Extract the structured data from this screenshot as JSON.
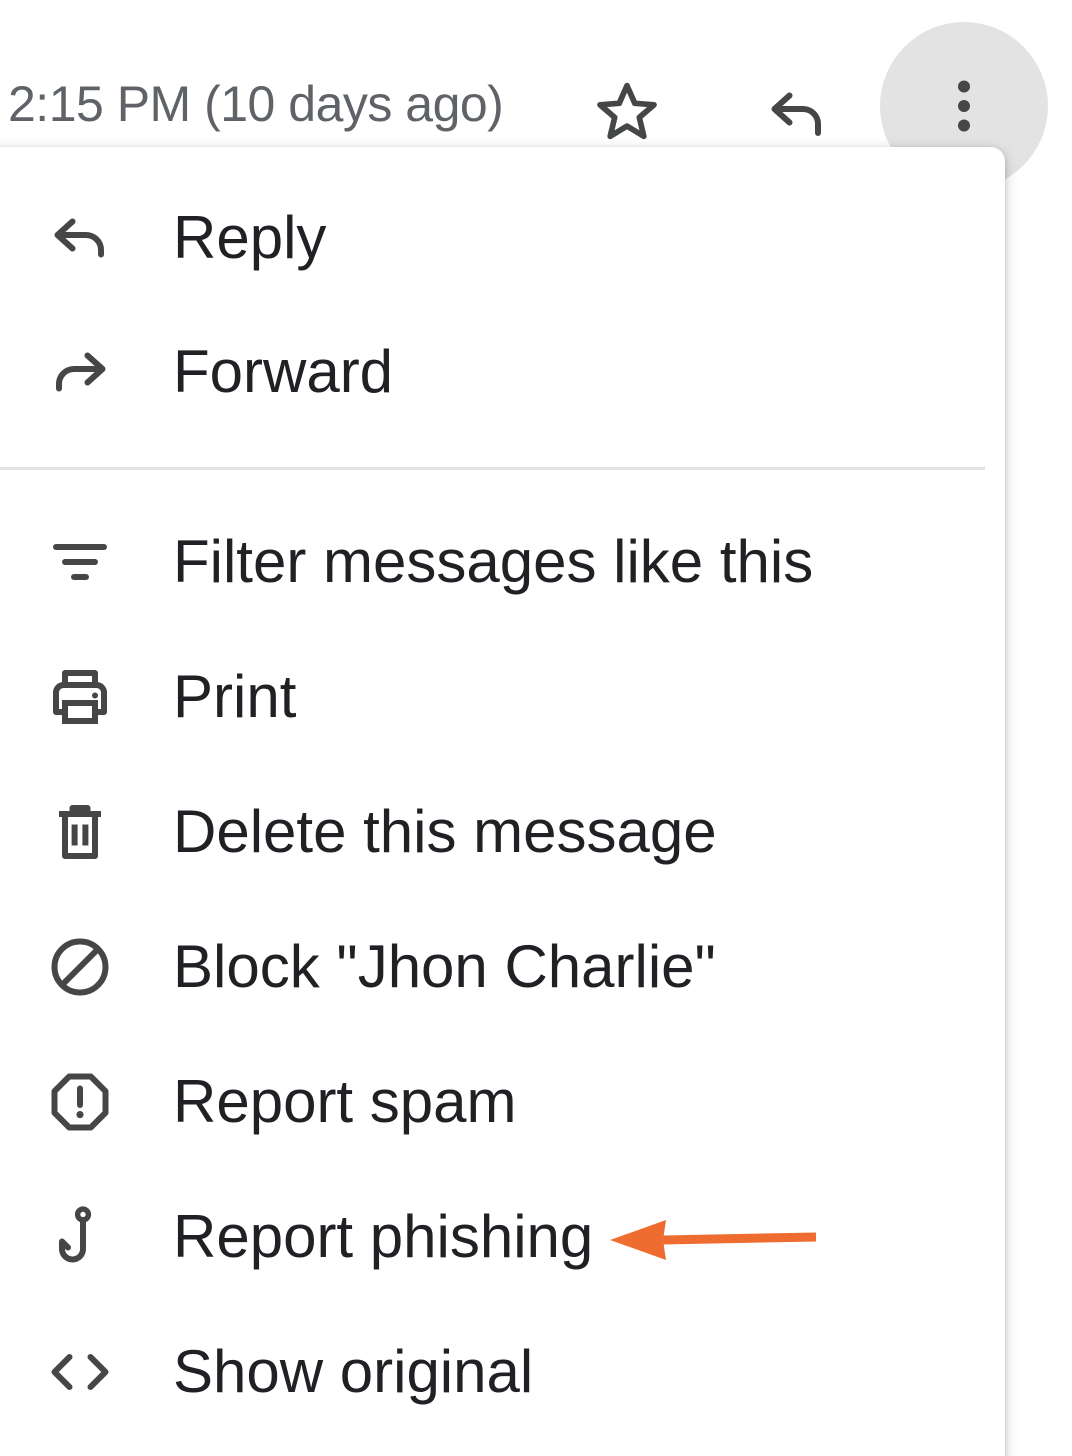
{
  "header": {
    "timestamp": "2:15 PM (10 days ago)",
    "star_icon": "star-outline-icon",
    "reply_icon": "reply-icon",
    "more_icon": "more-vert-icon"
  },
  "menu": {
    "items": [
      {
        "label": "Reply",
        "icon": "reply-icon"
      },
      {
        "label": "Forward",
        "icon": "forward-icon"
      },
      {
        "label": "Filter messages like this",
        "icon": "filter-icon"
      },
      {
        "label": "Print",
        "icon": "print-icon"
      },
      {
        "label": "Delete this message",
        "icon": "trash-icon"
      },
      {
        "label": "Block \"Jhon Charlie\"",
        "icon": "block-icon"
      },
      {
        "label": "Report spam",
        "icon": "report-icon"
      },
      {
        "label": "Report phishing",
        "icon": "phishing-hook-icon"
      },
      {
        "label": "Show original",
        "icon": "code-icon"
      }
    ]
  },
  "annotation": {
    "arrow_color": "#ee6c2f",
    "points_to": "Report phishing"
  },
  "colors": {
    "icon": "#444746",
    "text": "#202124",
    "muted_text": "#5f6368",
    "more_button_bg": "#e3e3e3"
  }
}
